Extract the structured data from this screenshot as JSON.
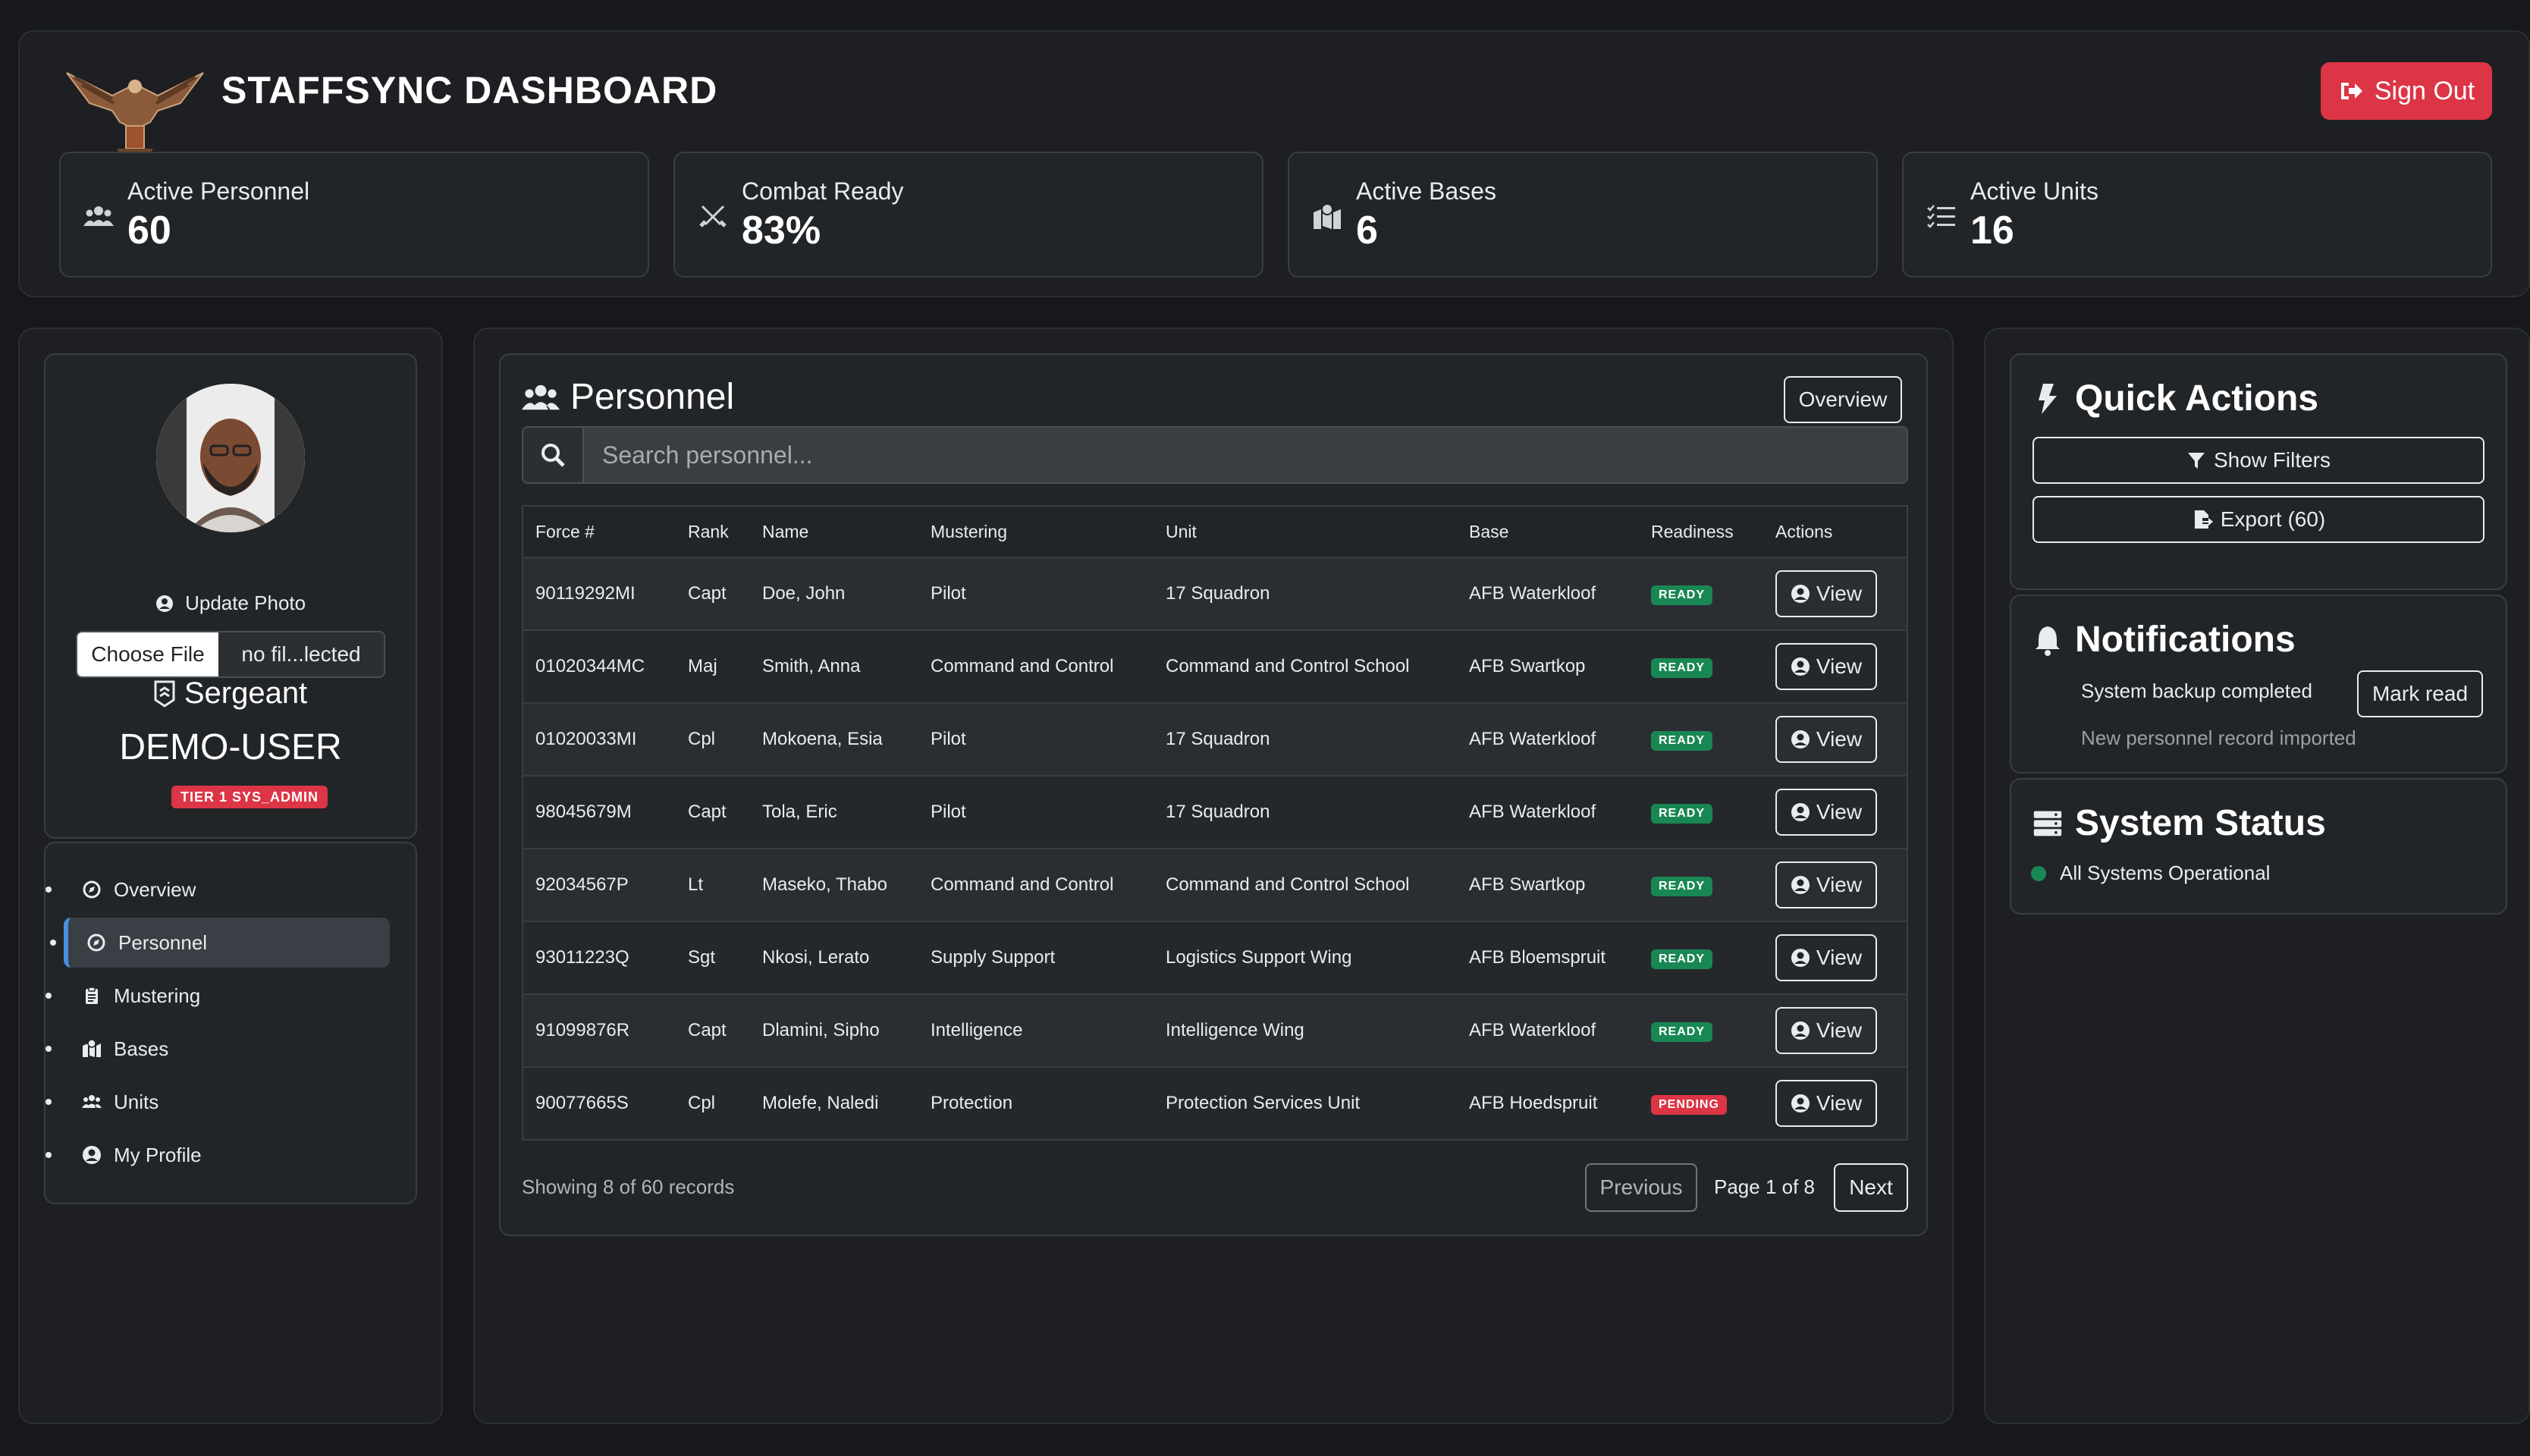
{
  "header": {
    "title": "STAFFSYNC DASHBOARD",
    "sign_out": "Sign Out",
    "stats": [
      {
        "label": "Active Personnel",
        "value": "60",
        "icon": "users-icon"
      },
      {
        "label": "Combat Ready",
        "value": "83%",
        "icon": "crossed-swords-icon"
      },
      {
        "label": "Active Bases",
        "value": "6",
        "icon": "map-icon"
      },
      {
        "label": "Active Units",
        "value": "16",
        "icon": "list-icon"
      }
    ]
  },
  "profile": {
    "update_photo": "Update Photo",
    "choose_file": "Choose File",
    "no_file": "no fil...lected",
    "rank": "Sergeant",
    "username": "DEMO-USER",
    "tier": "TIER 1 SYS_ADMIN"
  },
  "nav": {
    "items": [
      {
        "label": "Overview",
        "icon": "compass-icon"
      },
      {
        "label": "Personnel",
        "icon": "compass-icon",
        "active": true
      },
      {
        "label": "Mustering",
        "icon": "clipboard-icon"
      },
      {
        "label": "Bases",
        "icon": "map-icon"
      },
      {
        "label": "Units",
        "icon": "users-icon"
      },
      {
        "label": "My Profile",
        "icon": "user-circle-icon"
      }
    ]
  },
  "personnel": {
    "title": "Personnel",
    "overview_button": "Overview",
    "search_placeholder": "Search personnel...",
    "columns": [
      "Force #",
      "Rank",
      "Name",
      "Mustering",
      "Unit",
      "Base",
      "Readiness",
      "Actions"
    ],
    "rows": [
      {
        "force": "90119292MI",
        "rank": "Capt",
        "name": "Doe, John",
        "mustering": "Pilot",
        "unit": "17 Squadron",
        "base": "AFB Waterkloof",
        "readiness": "READY",
        "action": "View"
      },
      {
        "force": "01020344MC",
        "rank": "Maj",
        "name": "Smith, Anna",
        "mustering": "Command and Control",
        "unit": "Command and Control School",
        "base": "AFB Swartkop",
        "readiness": "READY",
        "action": "View"
      },
      {
        "force": "01020033MI",
        "rank": "Cpl",
        "name": "Mokoena, Esia",
        "mustering": "Pilot",
        "unit": "17 Squadron",
        "base": "AFB Waterkloof",
        "readiness": "READY",
        "action": "View"
      },
      {
        "force": "98045679M",
        "rank": "Capt",
        "name": "Tola, Eric",
        "mustering": "Pilot",
        "unit": "17 Squadron",
        "base": "AFB Waterkloof",
        "readiness": "READY",
        "action": "View"
      },
      {
        "force": "92034567P",
        "rank": "Lt",
        "name": "Maseko, Thabo",
        "mustering": "Command and Control",
        "unit": "Command and Control School",
        "base": "AFB Swartkop",
        "readiness": "READY",
        "action": "View"
      },
      {
        "force": "93011223Q",
        "rank": "Sgt",
        "name": "Nkosi, Lerato",
        "mustering": "Supply Support",
        "unit": "Logistics Support Wing",
        "base": "AFB Bloemspruit",
        "readiness": "READY",
        "action": "View"
      },
      {
        "force": "91099876R",
        "rank": "Capt",
        "name": "Dlamini, Sipho",
        "mustering": "Intelligence",
        "unit": "Intelligence Wing",
        "base": "AFB Waterkloof",
        "readiness": "READY",
        "action": "View"
      },
      {
        "force": "90077665S",
        "rank": "Cpl",
        "name": "Molefe, Naledi",
        "mustering": "Protection",
        "unit": "Protection Services Unit",
        "base": "AFB Hoedspruit",
        "readiness": "PENDING",
        "action": "View"
      }
    ],
    "footer": "Showing 8 of 60 records",
    "previous": "Previous",
    "page_info": "Page 1 of 8",
    "next": "Next"
  },
  "quick_actions": {
    "title": "Quick Actions",
    "show_filters": "Show Filters",
    "export": "Export (60)"
  },
  "notifications": {
    "title": "Notifications",
    "items": [
      "System backup completed",
      "New personnel record imported"
    ],
    "mark_read": "Mark read"
  },
  "system_status": {
    "title": "System Status",
    "status": "All Systems Operational"
  },
  "colors": {
    "background": "#16181b",
    "danger": "#dc3545",
    "success": "#198754",
    "accent": "#4a90e2"
  }
}
